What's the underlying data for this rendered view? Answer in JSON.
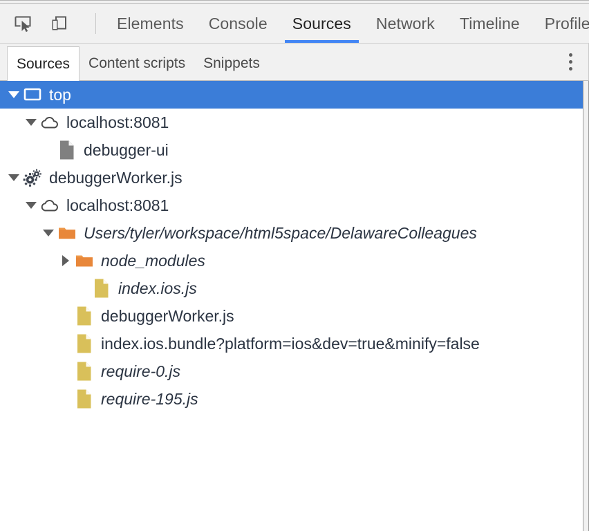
{
  "window": {
    "app": "Chrome DevTools"
  },
  "toolbar": {
    "inspect_icon": "inspect-element-icon",
    "device_icon": "device-toolbar-icon",
    "tabs": [
      {
        "label": "Elements",
        "active": false
      },
      {
        "label": "Console",
        "active": false
      },
      {
        "label": "Sources",
        "active": true
      },
      {
        "label": "Network",
        "active": false
      },
      {
        "label": "Timeline",
        "active": false
      },
      {
        "label": "Profiles",
        "active": false
      }
    ],
    "accent_color": "#4285f4"
  },
  "subtoolbar": {
    "tabs": [
      {
        "label": "Sources",
        "active": true
      },
      {
        "label": "Content scripts",
        "active": false
      },
      {
        "label": "Snippets",
        "active": false
      }
    ],
    "menu_icon": "more-options-kebab-icon"
  },
  "navigator": {
    "selection_color": "#3b7dd8",
    "rows": [
      {
        "label": "top",
        "indent": 0,
        "twisty": "open",
        "icon": "frame-icon",
        "italic": false,
        "selected": true
      },
      {
        "label": "localhost:8081",
        "indent": 1,
        "twisty": "open",
        "icon": "cloud-icon",
        "italic": false,
        "selected": false
      },
      {
        "label": "debugger-ui",
        "indent": 2,
        "twisty": "none",
        "icon": "document-gray-icon",
        "italic": false,
        "selected": false
      },
      {
        "label": "debuggerWorker.js",
        "indent": 0,
        "twisty": "open",
        "icon": "worker-gears-icon",
        "italic": false,
        "selected": false
      },
      {
        "label": "localhost:8081",
        "indent": 1,
        "twisty": "open",
        "icon": "cloud-icon",
        "italic": false,
        "selected": false
      },
      {
        "label": "Users/tyler/workspace/html5space/DelawareColleagues",
        "indent": 2,
        "twisty": "open",
        "icon": "folder-orange-icon",
        "italic": true,
        "selected": false
      },
      {
        "label": "node_modules",
        "indent": 3,
        "twisty": "closed",
        "icon": "folder-orange-icon",
        "italic": true,
        "selected": false
      },
      {
        "label": "index.ios.js",
        "indent": 4,
        "twisty": "none",
        "icon": "script-yellow-icon",
        "italic": true,
        "selected": false
      },
      {
        "label": "debuggerWorker.js",
        "indent": 3,
        "twisty": "none",
        "icon": "script-yellow-icon",
        "italic": false,
        "selected": false
      },
      {
        "label": "index.ios.bundle?platform=ios&dev=true&minify=false",
        "indent": 3,
        "twisty": "none",
        "icon": "script-yellow-icon",
        "italic": false,
        "selected": false
      },
      {
        "label": "require-0.js",
        "indent": 3,
        "twisty": "none",
        "icon": "script-yellow-icon",
        "italic": true,
        "selected": false
      },
      {
        "label": "require-195.js",
        "indent": 3,
        "twisty": "none",
        "icon": "script-yellow-icon",
        "italic": true,
        "selected": false
      }
    ]
  }
}
